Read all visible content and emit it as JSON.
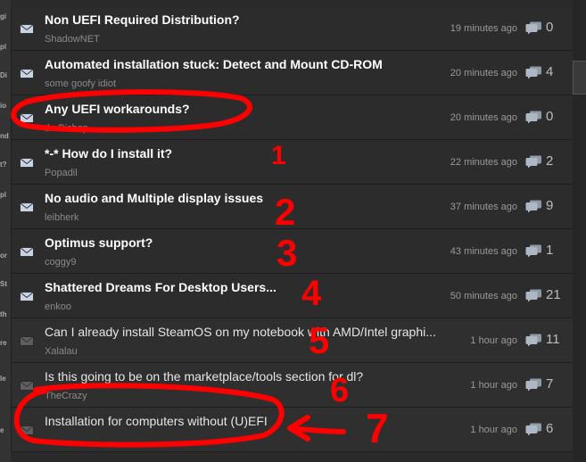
{
  "topics": [
    {
      "title": "Non UEFI Required Distribution?",
      "author": "ShadowNET",
      "time": "19 minutes ago",
      "replies": "0",
      "unread": true
    },
    {
      "title": "Automated installation stuck: Detect and Mount CD-ROM",
      "author": "some goofy idiot",
      "time": "20 minutes ago",
      "replies": "4",
      "unread": true
    },
    {
      "title": "Any UEFI workarounds?",
      "author": "theBishop",
      "time": "20 minutes ago",
      "replies": "0",
      "unread": true
    },
    {
      "title": "*-* How do I install it?",
      "author": "Popadil",
      "time": "22 minutes ago",
      "replies": "2",
      "unread": true
    },
    {
      "title": "No audio and Multiple display issues",
      "author": "leibherk",
      "time": "37 minutes ago",
      "replies": "9",
      "unread": true
    },
    {
      "title": "Optimus support?",
      "author": "coggy9",
      "time": "43 minutes ago",
      "replies": "1",
      "unread": true
    },
    {
      "title": "Shattered Dreams For Desktop Users...",
      "author": "enkoo",
      "time": "50 minutes ago",
      "replies": "21",
      "unread": true
    },
    {
      "title": "Can I already install SteamOS on my notebook with AMD/Intel graphi...",
      "author": "Xalalau",
      "time": "1 hour ago",
      "replies": "11",
      "unread": false
    },
    {
      "title": "Is this going to be on the marketplace/tools section for dl?",
      "author": "TheCrazy",
      "time": "1 hour ago",
      "replies": "7",
      "unread": false
    },
    {
      "title": "Installation for computers without (U)EFI",
      "author": "",
      "time": "1 hour ago",
      "replies": "6",
      "unread": false
    }
  ],
  "annotations": {
    "numbers": [
      "1",
      "2",
      "3",
      "4",
      "5",
      "6",
      "7"
    ],
    "color": "#ff0000"
  },
  "sidebar_fragments": [
    "gi",
    "pl",
    "Di",
    "io",
    "nd",
    "t?",
    "pl",
    "or",
    "St",
    "th",
    "re",
    "le",
    "e"
  ],
  "colors": {
    "background": "#2a2a2a",
    "row": "#2c2c2c",
    "title": "#ffffff",
    "meta": "#8a8a8a",
    "envelope_unread": "#c8d4e6",
    "envelope_read": "#5e5e5e",
    "comment_icon": "#aeb8c4"
  }
}
